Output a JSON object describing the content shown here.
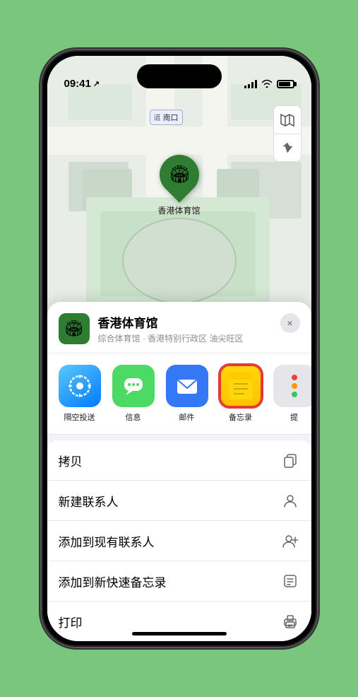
{
  "status_bar": {
    "time": "09:41",
    "location_arrow": "↗"
  },
  "map": {
    "road_label": "南口",
    "map_icon": "🗺",
    "location_icon": "➤"
  },
  "venue": {
    "name": "香港体育馆",
    "subtitle": "综合体育馆 · 香港特别行政区 油尖旺区",
    "close_label": "×",
    "icon": "🏟"
  },
  "share_items": [
    {
      "label": "隔空投送",
      "type": "airdrop"
    },
    {
      "label": "信息",
      "type": "messages"
    },
    {
      "label": "邮件",
      "type": "mail"
    },
    {
      "label": "备忘录",
      "type": "notes"
    },
    {
      "label": "提",
      "type": "more"
    }
  ],
  "action_items": [
    {
      "label": "拷贝",
      "icon": "copy"
    },
    {
      "label": "新建联系人",
      "icon": "person"
    },
    {
      "label": "添加到现有联系人",
      "icon": "person-add"
    },
    {
      "label": "添加到新快速备忘录",
      "icon": "note"
    },
    {
      "label": "打印",
      "icon": "printer"
    }
  ],
  "more_dots": [
    {
      "color": "#ff3b30"
    },
    {
      "color": "#ff9500"
    },
    {
      "color": "#34c759"
    }
  ]
}
